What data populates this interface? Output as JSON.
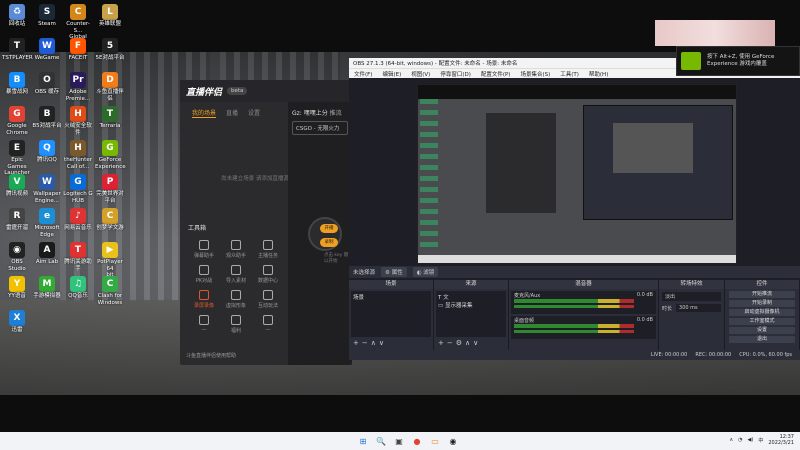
{
  "desktop_icons": [
    {
      "label": "回收站",
      "color": "#5b8bd6",
      "glyph": "♻"
    },
    {
      "label": "Steam",
      "color": "#1b2838",
      "glyph": "S"
    },
    {
      "label": "Counter-S...\nGlobal Off...",
      "color": "#d4861a",
      "glyph": "C"
    },
    {
      "label": "英雄联盟",
      "color": "#c8a24a",
      "glyph": "L"
    },
    {
      "label": "TSTPLAYER",
      "color": "#222",
      "glyph": "T"
    },
    {
      "label": "WeGame",
      "color": "#1e5bd6",
      "glyph": "W"
    },
    {
      "label": "FACEIT",
      "color": "#ff5500",
      "glyph": "F"
    },
    {
      "label": "5E对战平台",
      "color": "#222",
      "glyph": "5"
    },
    {
      "label": "暴雪战网",
      "color": "#148eff",
      "glyph": "B"
    },
    {
      "label": "OBS 缓存",
      "color": "#333",
      "glyph": "O"
    },
    {
      "label": "Adobe\nPremie...",
      "color": "#2a1b5a",
      "glyph": "Pr"
    },
    {
      "label": "斗鱼直播伴侣",
      "color": "#f27c1a",
      "glyph": "D"
    },
    {
      "label": "Google\nChrome",
      "color": "#e34133",
      "glyph": "G"
    },
    {
      "label": "B5对战平台",
      "color": "#222",
      "glyph": "B"
    },
    {
      "label": "火绒安全软件",
      "color": "#e04b1a",
      "glyph": "H"
    },
    {
      "label": "Terraria",
      "color": "#2c6b2c",
      "glyph": "T"
    },
    {
      "label": "Epic Games\nLauncher",
      "color": "#222",
      "glyph": "E"
    },
    {
      "label": "腾讯QQ",
      "color": "#1e90ff",
      "glyph": "Q"
    },
    {
      "label": "theHunter\nCall of...",
      "color": "#7a5a2a",
      "glyph": "H"
    },
    {
      "label": "GeForce\nExperience",
      "color": "#76b900",
      "glyph": "G"
    },
    {
      "label": "腾讯视频",
      "color": "#1aaa55",
      "glyph": "V"
    },
    {
      "label": "Wallpaper\nEngine...",
      "color": "#2a5aa8",
      "glyph": "W"
    },
    {
      "label": "Logitech G\nHUB",
      "color": "#0a6ad6",
      "glyph": "G"
    },
    {
      "label": "完美世界对\n平台",
      "color": "#d23",
      "glyph": "P"
    },
    {
      "label": "雷霆开溜",
      "color": "#444",
      "glyph": "R"
    },
    {
      "label": "Microsoft\nEdge",
      "color": "#1b8fd6",
      "glyph": "e"
    },
    {
      "label": "网易云音乐",
      "color": "#d33",
      "glyph": "♪"
    },
    {
      "label": "创梦学文游",
      "color": "#d3a12a",
      "glyph": "C"
    },
    {
      "label": "OBS Studio",
      "color": "#222",
      "glyph": "◉"
    },
    {
      "label": "Aim Lab",
      "color": "#1a1a1a",
      "glyph": "A"
    },
    {
      "label": "腾讯关游助手",
      "color": "#d33",
      "glyph": "T"
    },
    {
      "label": "PotPlayer 64\nbit",
      "color": "#e8c21a",
      "glyph": "▶"
    },
    {
      "label": "YY语音",
      "color": "#f2c200",
      "glyph": "Y"
    },
    {
      "label": "手游模拟器",
      "color": "#3a3",
      "glyph": "M"
    },
    {
      "label": "QQ音乐",
      "color": "#31c27c",
      "glyph": "♫"
    },
    {
      "label": "Clash for\nWindows",
      "color": "#3a4",
      "glyph": "C"
    },
    {
      "label": "迅雷",
      "color": "#1e7fd6",
      "glyph": "X"
    }
  ],
  "companion": {
    "logo": "直播伴侣",
    "version": "beta",
    "tabs": [
      "我的场景",
      "直播",
      "设置"
    ],
    "empty_text": "尚未建立场景 请添加直播源开始直播",
    "tools_title": "工具箱",
    "tools": [
      {
        "label": "弹幕助手"
      },
      {
        "label": "观众助手"
      },
      {
        "label": "主播任务"
      },
      {
        "label": "PK对战"
      },
      {
        "label": "导入素材"
      },
      {
        "label": "数据中心"
      },
      {
        "label": "录屏录像",
        "highlight": true
      },
      {
        "label": "虚拟形象"
      },
      {
        "label": "互动玩法"
      },
      {
        "label": "—"
      },
      {
        "label": "福利"
      },
      {
        "label": "—"
      }
    ],
    "footer": "斗鱼直播伴侣使用帮助",
    "scene_label": "Gz: 嘿嘿上分",
    "scene_action": "推流",
    "game_label": "CSGO - 无限火力",
    "btn_start": "开播",
    "btn_record": "录制",
    "hint": "点击 key 键以开始"
  },
  "obs": {
    "title": "OBS 27.1.3 (64-bit, windows) - 配置文件: 未命名 - 场景: 未命名",
    "menu": [
      "文件(F)",
      "编辑(E)",
      "视图(V)",
      "停靠窗口(D)",
      "配置文件(P)",
      "场景集合(S)",
      "工具(T)",
      "帮助(H)"
    ],
    "no_source": "未选择源",
    "props_btn": "属性",
    "filter_btn": "滤镜",
    "docks": {
      "scenes": "场景",
      "sources": "来源",
      "mixer": "混音器",
      "transitions": "转场特效",
      "controls": "控件"
    },
    "scene_item": "场景",
    "source_items": [
      "文",
      "显示器采集"
    ],
    "mixer_channels": [
      {
        "name": "桌面音频",
        "db": "0.0 dB"
      },
      {
        "name": "麦克风/Aux",
        "db": "0.0 dB"
      }
    ],
    "transition": {
      "type_label": "淡出",
      "duration_label": "时长",
      "duration_value": "300 ms"
    },
    "controls": [
      "开始推流",
      "开始录制",
      "启动虚拟摄像机",
      "工作室模式",
      "设置",
      "退出"
    ],
    "status": {
      "live": "LIVE: 00:00:00",
      "rec": "REC: 00:00:00",
      "cpu": "CPU: 0.0%, 60.00 fps"
    }
  },
  "geforce": {
    "text1": "按下 Alt+Z, 使用 GeForce",
    "text2": "Experience 游戏内覆盖"
  },
  "taskbar": {
    "time": "12:37",
    "date": "2022/3/21",
    "apps": [
      "⊞",
      "🔍",
      "▣",
      "●",
      "▭",
      "◉"
    ]
  }
}
